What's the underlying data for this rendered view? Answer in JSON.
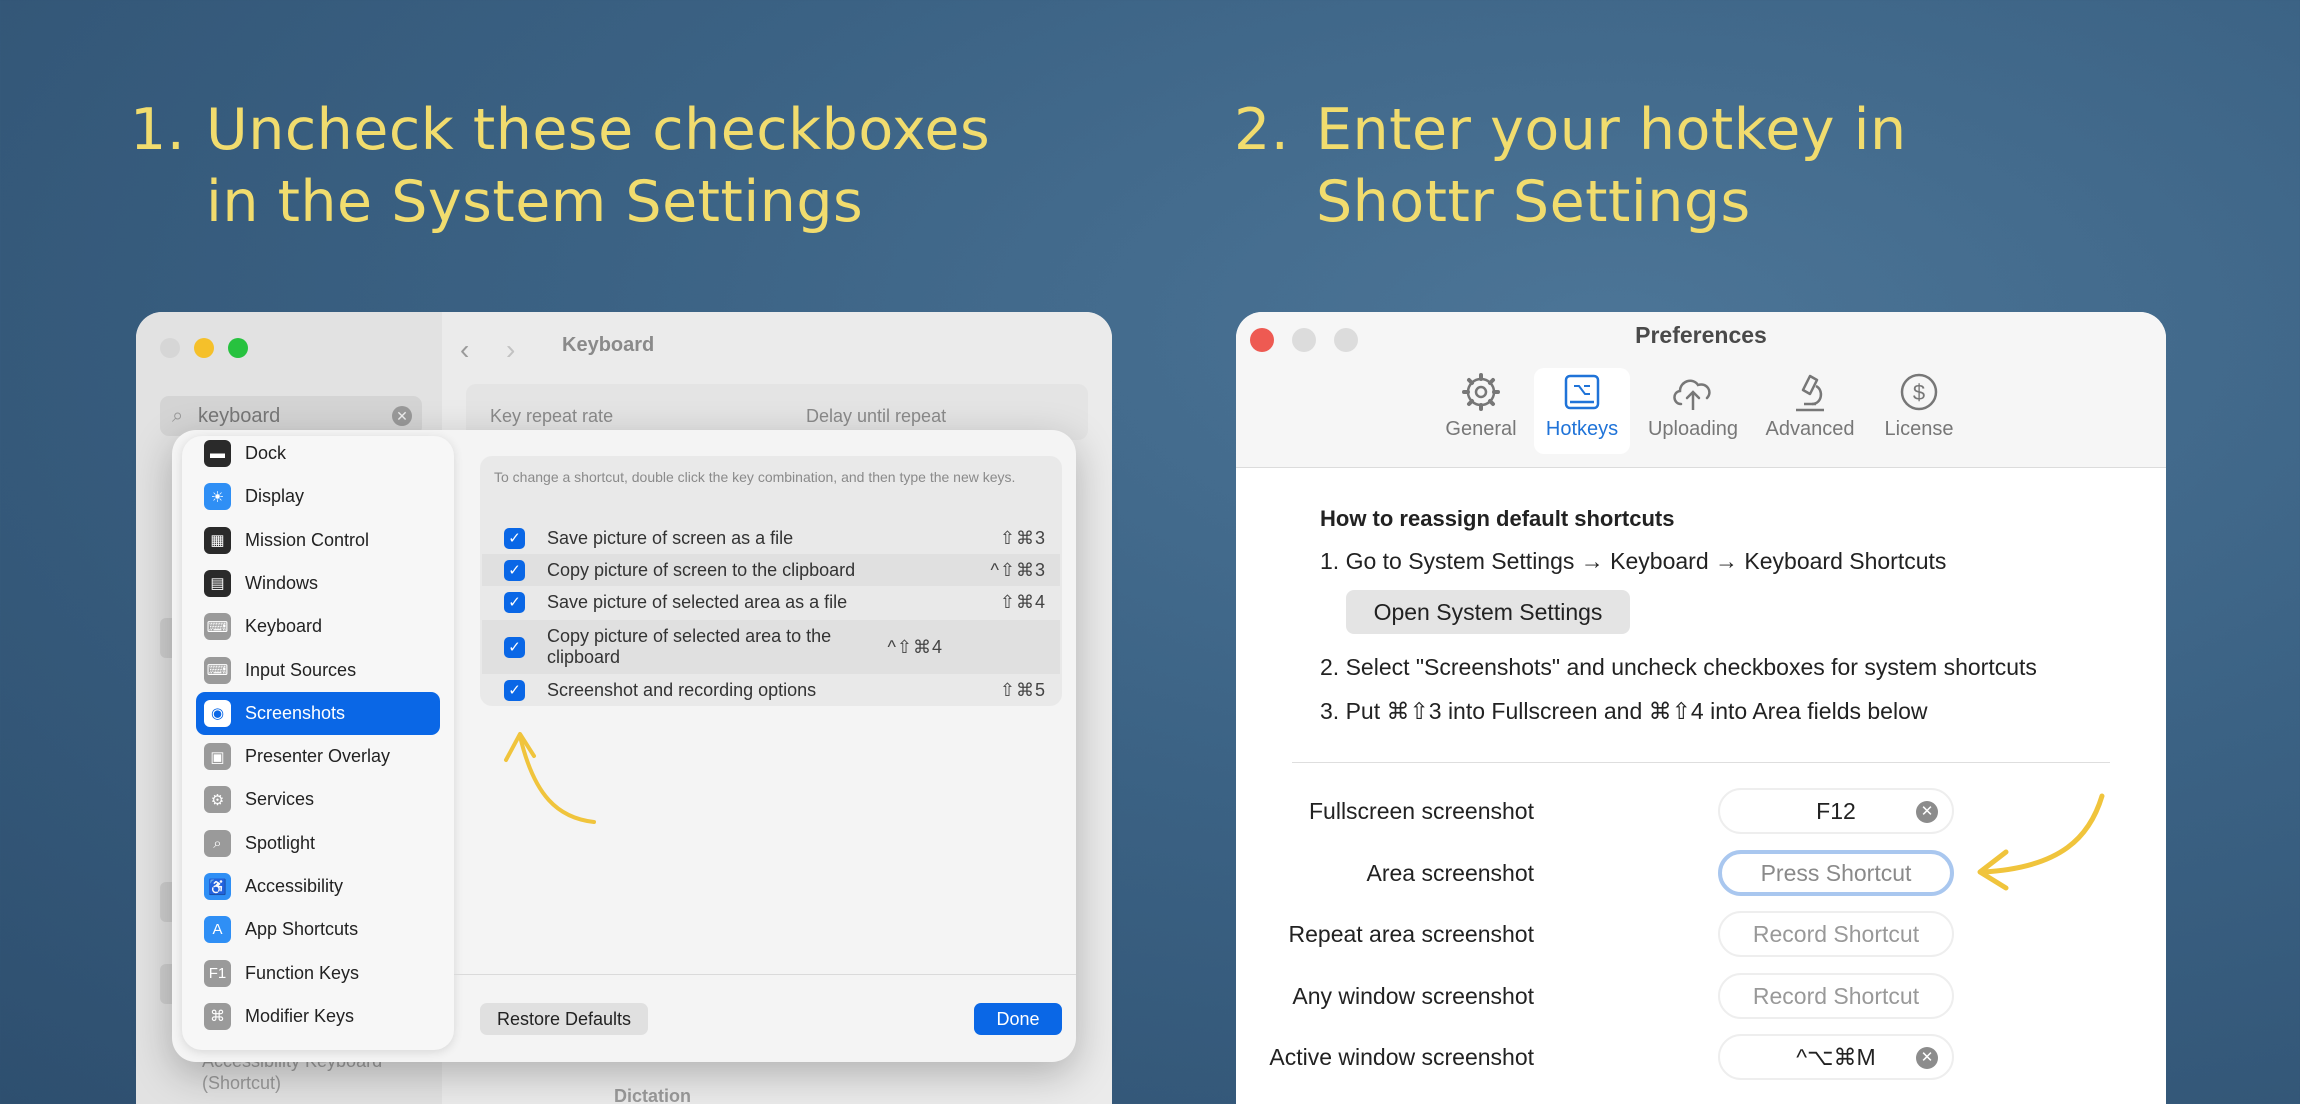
{
  "step1": {
    "number": "1.",
    "line1": "Uncheck these checkboxes",
    "line2": "in the System Settings"
  },
  "step2": {
    "number": "2.",
    "line1": "Enter your hotkey in",
    "line2": "Shottr Settings"
  },
  "system_settings": {
    "search_value": "keyboard",
    "window_title": "Keyboard",
    "bg_row": {
      "left": "Key repeat rate",
      "right": "Delay until repeat"
    },
    "bg_footer_left": [
      "Accessibility Keyboard",
      "(Shortcut)"
    ],
    "bg_footer_right": "Dictation",
    "categories": [
      {
        "label": "Dock",
        "icon": "dock-icon",
        "color": "#2a2a2a"
      },
      {
        "label": "Display",
        "icon": "display-icon",
        "color": "#2f8ff5"
      },
      {
        "label": "Mission Control",
        "icon": "mission-control-icon",
        "color": "#2a2a2a"
      },
      {
        "label": "Windows",
        "icon": "windows-icon",
        "color": "#2a2a2a"
      },
      {
        "label": "Keyboard",
        "icon": "keyboard-icon",
        "color": "#9a9a9a"
      },
      {
        "label": "Input Sources",
        "icon": "input-sources-icon",
        "color": "#9a9a9a"
      },
      {
        "label": "Screenshots",
        "icon": "screenshots-icon",
        "color": "#ffffff",
        "selected": true
      },
      {
        "label": "Presenter Overlay",
        "icon": "presenter-overlay-icon",
        "color": "#9a9a9a"
      },
      {
        "label": "Services",
        "icon": "services-icon",
        "color": "#9a9a9a"
      },
      {
        "label": "Spotlight",
        "icon": "spotlight-icon",
        "color": "#9a9a9a"
      },
      {
        "label": "Accessibility",
        "icon": "accessibility-icon",
        "color": "#2f8ff5"
      },
      {
        "label": "App Shortcuts",
        "icon": "app-shortcuts-icon",
        "color": "#2f8ff5"
      },
      {
        "label": "Function Keys",
        "icon": "function-keys-icon",
        "color": "#9a9a9a"
      },
      {
        "label": "Modifier Keys",
        "icon": "modifier-keys-icon",
        "color": "#9a9a9a"
      }
    ],
    "hint": "To change a shortcut, double click the key combination, and then type the new keys.",
    "shortcuts": [
      {
        "label": "Save picture of screen as a file",
        "keys": "⇧⌘3",
        "checked": true
      },
      {
        "label": "Copy picture of screen to the clipboard",
        "keys": "^⇧⌘3",
        "checked": true
      },
      {
        "label": "Save picture of selected area as a file",
        "keys": "⇧⌘4",
        "checked": true
      },
      {
        "label": "Copy picture of selected area to the clipboard",
        "keys": "^⇧⌘4",
        "checked": true
      },
      {
        "label": "Screenshot and recording options",
        "keys": "⇧⌘5",
        "checked": true
      }
    ],
    "restore_label": "Restore Defaults",
    "done_label": "Done"
  },
  "preferences": {
    "title": "Preferences",
    "tabs": [
      {
        "label": "General",
        "icon": "gear-icon"
      },
      {
        "label": "Hotkeys",
        "icon": "keyboard-hotkey-icon",
        "selected": true
      },
      {
        "label": "Uploading",
        "icon": "cloud-upload-icon"
      },
      {
        "label": "Advanced",
        "icon": "microscope-icon"
      },
      {
        "label": "License",
        "icon": "dollar-icon"
      }
    ],
    "howto_title": "How to reassign default shortcuts",
    "step_1": "1. Go to System Settings → Keyboard → Keyboard Shortcuts",
    "open_button": "Open System Settings",
    "step_2": "2. Select \"Screenshots\" and uncheck checkboxes for system shortcuts",
    "step_3": "3. Put ⌘⇧3 into Fullscreen and ⌘⇧4 into Area fields below",
    "hotkeys": [
      {
        "label": "Fullscreen screenshot",
        "value": "F12",
        "state": "set"
      },
      {
        "label": "Area screenshot",
        "value": "Press Shortcut",
        "state": "focus"
      },
      {
        "label": "Repeat area screenshot",
        "value": "Record Shortcut",
        "state": "empty"
      },
      {
        "label": "Any window screenshot",
        "value": "Record Shortcut",
        "state": "empty"
      },
      {
        "label": "Active window screenshot",
        "value": "^⌥⌘M",
        "state": "set"
      }
    ]
  },
  "colors": {
    "accent_blue": "#0a67e6",
    "annotation_yellow": "#f1dc6e",
    "arrow_yellow": "#f0c43c"
  }
}
